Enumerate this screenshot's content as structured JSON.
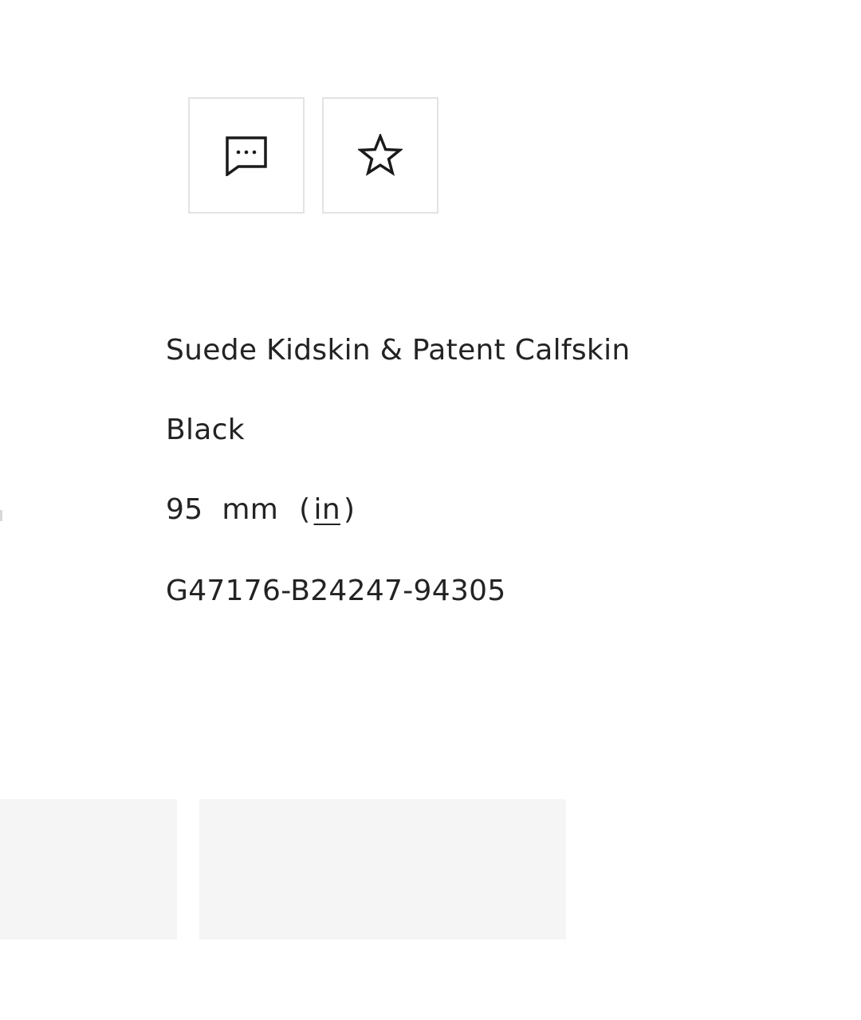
{
  "actions": {
    "message_icon": "message-dots-icon",
    "favorite_icon": "star-outline-icon"
  },
  "product": {
    "material": "Suede Kidskin & Patent Calfskin",
    "color": "Black",
    "heel_height": {
      "value": "95",
      "unit": "mm",
      "paren_open": "(",
      "alt_unit_link": "in",
      "paren_close": ")"
    },
    "sku": "G47176-B24247-94305"
  },
  "thumbnails": [
    {
      "label": ""
    },
    {
      "label": ""
    }
  ],
  "colors": {
    "text": "#232323",
    "button_border": "#e3e3e3",
    "thumbnail_bg": "#f5f5f5"
  }
}
